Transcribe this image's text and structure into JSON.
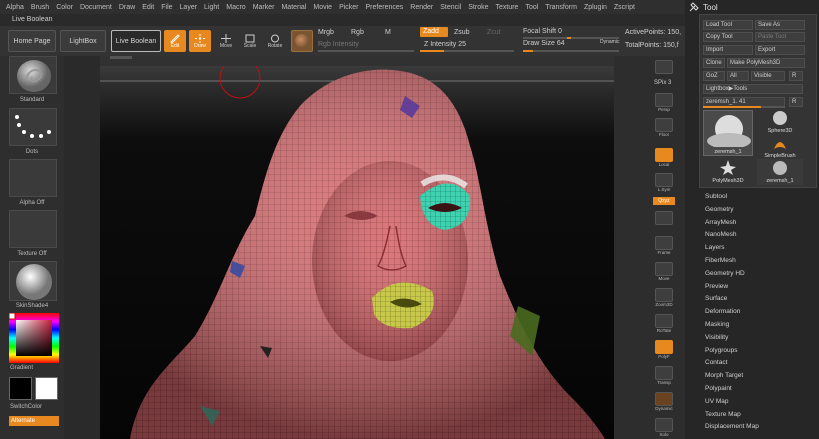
{
  "menu": [
    "Alpha",
    "Brush",
    "Color",
    "Document",
    "Draw",
    "Edit",
    "File",
    "Layer",
    "Light",
    "Macro",
    "Marker",
    "Material",
    "Movie",
    "Picker",
    "Preferences",
    "Render",
    "Stencil",
    "Stroke",
    "Texture",
    "Tool",
    "Transform",
    "Zplugin",
    "Zscript"
  ],
  "title": "Live Boolean",
  "shelf": {
    "home": "Home Page",
    "lightbox": "LightBox",
    "liveboolean": "Live Boolean",
    "edit": "Edit",
    "draw": "Draw",
    "move": "Move",
    "scale": "Scale",
    "rotate": "Rotate",
    "mrgb": "Mrgb",
    "rgb": "Rgb",
    "m": "M",
    "rgb_intensity": "Rgb Intensity",
    "zadd": "Zadd",
    "zsub": "Zsub",
    "zcut": "Zcut",
    "z_intensity": "Z Intensity 25",
    "focal_shift": "Focal Shift 0",
    "draw_size": "Draw Size 64",
    "dynamic": "Dynamic",
    "active_points": "ActivePoints: 150,",
    "total_points": "TotalPoints: 150,f"
  },
  "left": {
    "standard": "Standard",
    "dots": "Dots",
    "alpha_off": "Alpha Off",
    "texture_off": "Texture Off",
    "skinshade": "SkinShade4",
    "gradient": "Gradient",
    "switchcolor": "SwitchColor",
    "alternate": "Alternate"
  },
  "dock": {
    "spix": "SPix 3",
    "dynamic": "Dynamic",
    "persp": "Persp",
    "floor": "Floor",
    "local": "Local",
    "lsym": "L.Sym",
    "xyz": "Qxyz",
    "frame": "Frame",
    "move": "Move",
    "zoom3d": "Zoom3D",
    "rotate": "RoTate",
    "polyf": "PolyF",
    "transp": "Transp",
    "dynamic2": "Dynamic",
    "solo": "Solo"
  },
  "tool": {
    "header": "Tool",
    "load": "Load Tool",
    "save_as": "Save As",
    "copy": "Copy Tool",
    "paste": "Paste Tool",
    "import": "Import",
    "export": "Export",
    "clone": "Clone",
    "make_polymesh": "Make PolyMesh3D",
    "goz": "GoZ",
    "all": "All",
    "visible": "Visible",
    "r": "R",
    "lightbox_tools": "Lightbox▶Tools",
    "zeremsh_slider": "zeremsh_1. 41",
    "thumbs": [
      "zeremsh_1",
      "Sphere3D",
      "SimpleBrush",
      "PolyMesh3D",
      "zeremsh_1"
    ],
    "items": [
      "Subtool",
      "Geometry",
      "ArrayMesh",
      "NanoMesh",
      "Layers",
      "FiberMesh",
      "Geometry HD",
      "Preview",
      "Surface",
      "Deformation",
      "Masking",
      "Visibility",
      "Polygroups",
      "Contact",
      "Morph Target",
      "Polypaint",
      "UV Map",
      "Texture Map",
      "Displacement Map"
    ]
  },
  "colors": {
    "accent": "#e8891f",
    "mesh": "#d96a6e",
    "lips": "#c8c94a",
    "eye": "#3fd1b0"
  }
}
